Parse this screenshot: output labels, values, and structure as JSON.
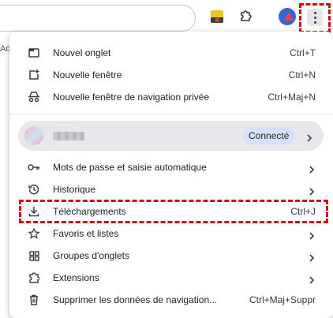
{
  "toolbar": {
    "behind_text": "Ad",
    "icons": [
      "extension-app-icon",
      "puzzle-icon",
      "profile-avatar-icon",
      "more-vert-icon"
    ]
  },
  "menu": {
    "items_top": [
      {
        "label": "Nouvel onglet",
        "shortcut": "Ctrl+T",
        "icon": "new-tab-icon"
      },
      {
        "label": "Nouvelle fenêtre",
        "shortcut": "Ctrl+N",
        "icon": "new-window-icon"
      },
      {
        "label": "Nouvelle fenêtre de navigation privée",
        "shortcut": "Ctrl+Maj+N",
        "icon": "incognito-icon"
      }
    ],
    "profile": {
      "status": "Connecté"
    },
    "items_bottom": [
      {
        "label": "Mots de passe et saisie automatique",
        "icon": "key-icon"
      },
      {
        "label": "Historique",
        "icon": "history-icon"
      },
      {
        "label": "Téléchargements",
        "shortcut": "Ctrl+J",
        "icon": "download-icon"
      },
      {
        "label": "Favoris et listes",
        "icon": "star-icon"
      },
      {
        "label": "Groupes d'onglets",
        "icon": "tab-groups-icon"
      },
      {
        "label": "Extensions",
        "icon": "extension-icon"
      },
      {
        "label": "Supprimer les données de navigation...",
        "shortcut": "Ctrl+Maj+Suppr",
        "icon": "trash-icon"
      }
    ]
  },
  "colors": {
    "highlight": "#d01010",
    "accent_badge": "#d6e2fb",
    "profile_row": "#e8e8ec"
  }
}
